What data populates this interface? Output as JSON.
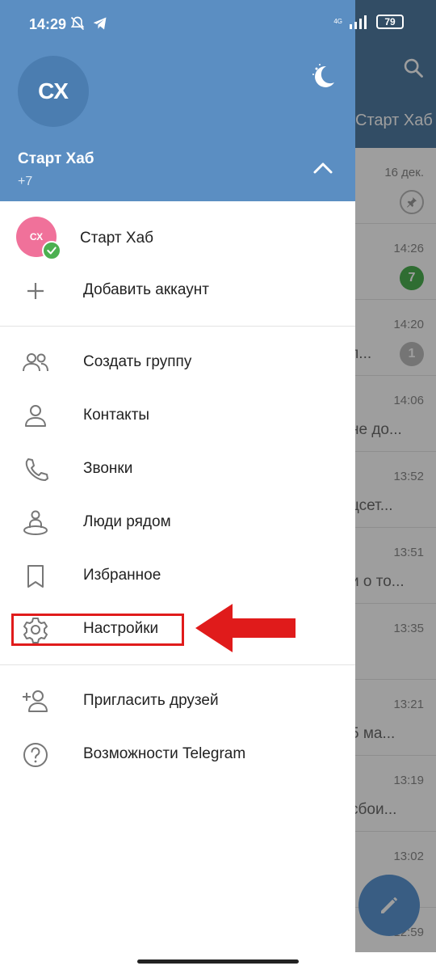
{
  "status_bar": {
    "time": "14:29",
    "network": "4G",
    "battery": "79"
  },
  "background": {
    "title": "Старт Хаб",
    "chats": [
      {
        "time": "16 дек.",
        "snippet": "",
        "badge": "pin"
      },
      {
        "time": "14:26",
        "snippet": "",
        "badge": "7"
      },
      {
        "time": "14:20",
        "snippet": "п...",
        "badge": "1"
      },
      {
        "time": "14:06",
        "snippet": "не до...",
        "badge": ""
      },
      {
        "time": "13:52",
        "snippet": "цсет...",
        "badge": ""
      },
      {
        "time": "13:51",
        "snippet": "и о то...",
        "badge": ""
      },
      {
        "time": "13:35",
        "snippet": "",
        "badge": ""
      },
      {
        "time": "13:21",
        "snippet": "5 ма...",
        "badge": ""
      },
      {
        "time": "13:19",
        "snippet": "сбои...",
        "badge": ""
      },
      {
        "time": "13:02",
        "snippet": "",
        "badge": ""
      },
      {
        "time": "12:59",
        "snippet": "",
        "badge": ""
      }
    ]
  },
  "drawer": {
    "avatar_initials": "СХ",
    "name": "Старт Хаб",
    "phone": "+7",
    "account": {
      "initials": "СХ",
      "name": "Старт Хаб"
    },
    "add_account": "Добавить аккаунт",
    "menu": {
      "new_group": "Создать группу",
      "contacts": "Контакты",
      "calls": "Звонки",
      "people_nearby": "Люди рядом",
      "saved": "Избранное",
      "settings": "Настройки",
      "invite": "Пригласить друзей",
      "features": "Возможности Telegram"
    }
  },
  "colors": {
    "header_blue": "#5b8ec2",
    "highlight_red": "#e01b1b",
    "online_green": "#4cb051",
    "account_pink": "#f0719a"
  }
}
